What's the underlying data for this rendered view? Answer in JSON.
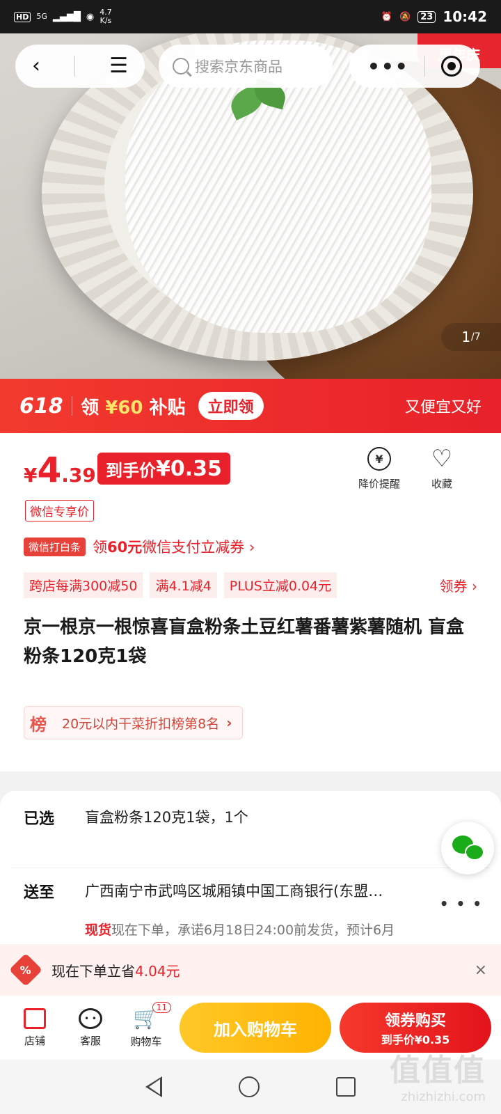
{
  "status_bar": {
    "left_hd": "HD",
    "net_type": "5G",
    "speed": "4.7",
    "speed_unit": "K/s",
    "battery": "23",
    "time": "10:42"
  },
  "nav": {
    "search_placeholder": "搜索京东商品",
    "badge_text": "周年庆"
  },
  "gallery": {
    "current": "1",
    "total": "/7"
  },
  "promo_banner": {
    "tag": "618",
    "text_prefix": "领 ",
    "amount": "¥60",
    "text_suffix": " 补贴",
    "button": "立即领",
    "right_text": "又便宜又好"
  },
  "price": {
    "symbol": "¥",
    "integer": "4",
    "decimal": ".39",
    "final_label": "到手价",
    "final_value": "¥0.35",
    "wechat_tag": "微信专享价"
  },
  "actions": {
    "price_alert": "降价提醒",
    "favorite": "收藏"
  },
  "coupon": {
    "tag": "微信打白条",
    "text_prefix": "领",
    "amount": "60元",
    "text_suffix": "微信支付立减券 ›"
  },
  "promo_chips": [
    "跨店每满300减50",
    "满4.1减4",
    "PLUS立减0.04元"
  ],
  "promo_get": "领券 ›",
  "product_title": "京一根京一根惊喜盲盒粉条土豆红薯番薯紫薯随机 盲盒粉条120克1袋",
  "rank": {
    "badge": "榜",
    "text": "20元以内干菜折扣榜第8名"
  },
  "selection": {
    "label": "已选",
    "value": "盲盒粉条120克1袋，1个"
  },
  "shipping": {
    "label": "送至",
    "address": "广西南宁市武鸣区城厢镇中国工商银行(东盟…",
    "stock": "现货",
    "promise": "现在下单，承诺6月18日24:00前发货，预计6月"
  },
  "save_bar": {
    "icon": "%",
    "text": "现在下单立省",
    "amount": "4.04元"
  },
  "bottom_bar": {
    "shop": "店铺",
    "service": "客服",
    "cart": "购物车",
    "cart_count": "11",
    "add_to_cart": "加入购物车",
    "buy_line1": "领券购买",
    "buy_line2": "到手价¥0.35"
  },
  "watermark": {
    "big": "值值值",
    "small": "zhizhizhi.com"
  }
}
